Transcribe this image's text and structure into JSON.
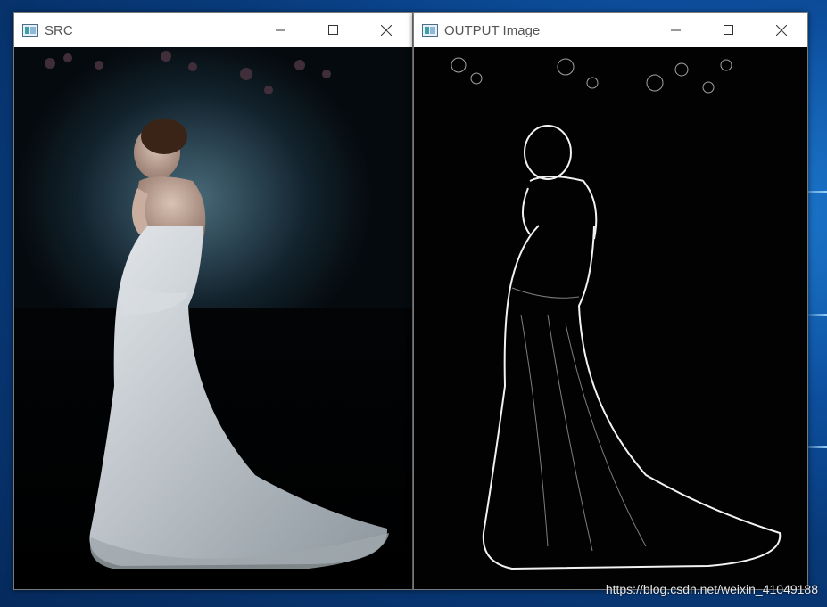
{
  "windows": [
    {
      "title": "SRC"
    },
    {
      "title": "OUTPUT Image"
    }
  ],
  "controls": {
    "minimize_icon": "minimize-icon",
    "maximize_icon": "maximize-icon",
    "close_icon": "close-icon"
  },
  "watermark": "https://blog.csdn.net/weixin_41049188",
  "colors": {
    "desktop": "#0d4f9e",
    "titlebar": "#ffffff",
    "image_background": "#000000"
  }
}
